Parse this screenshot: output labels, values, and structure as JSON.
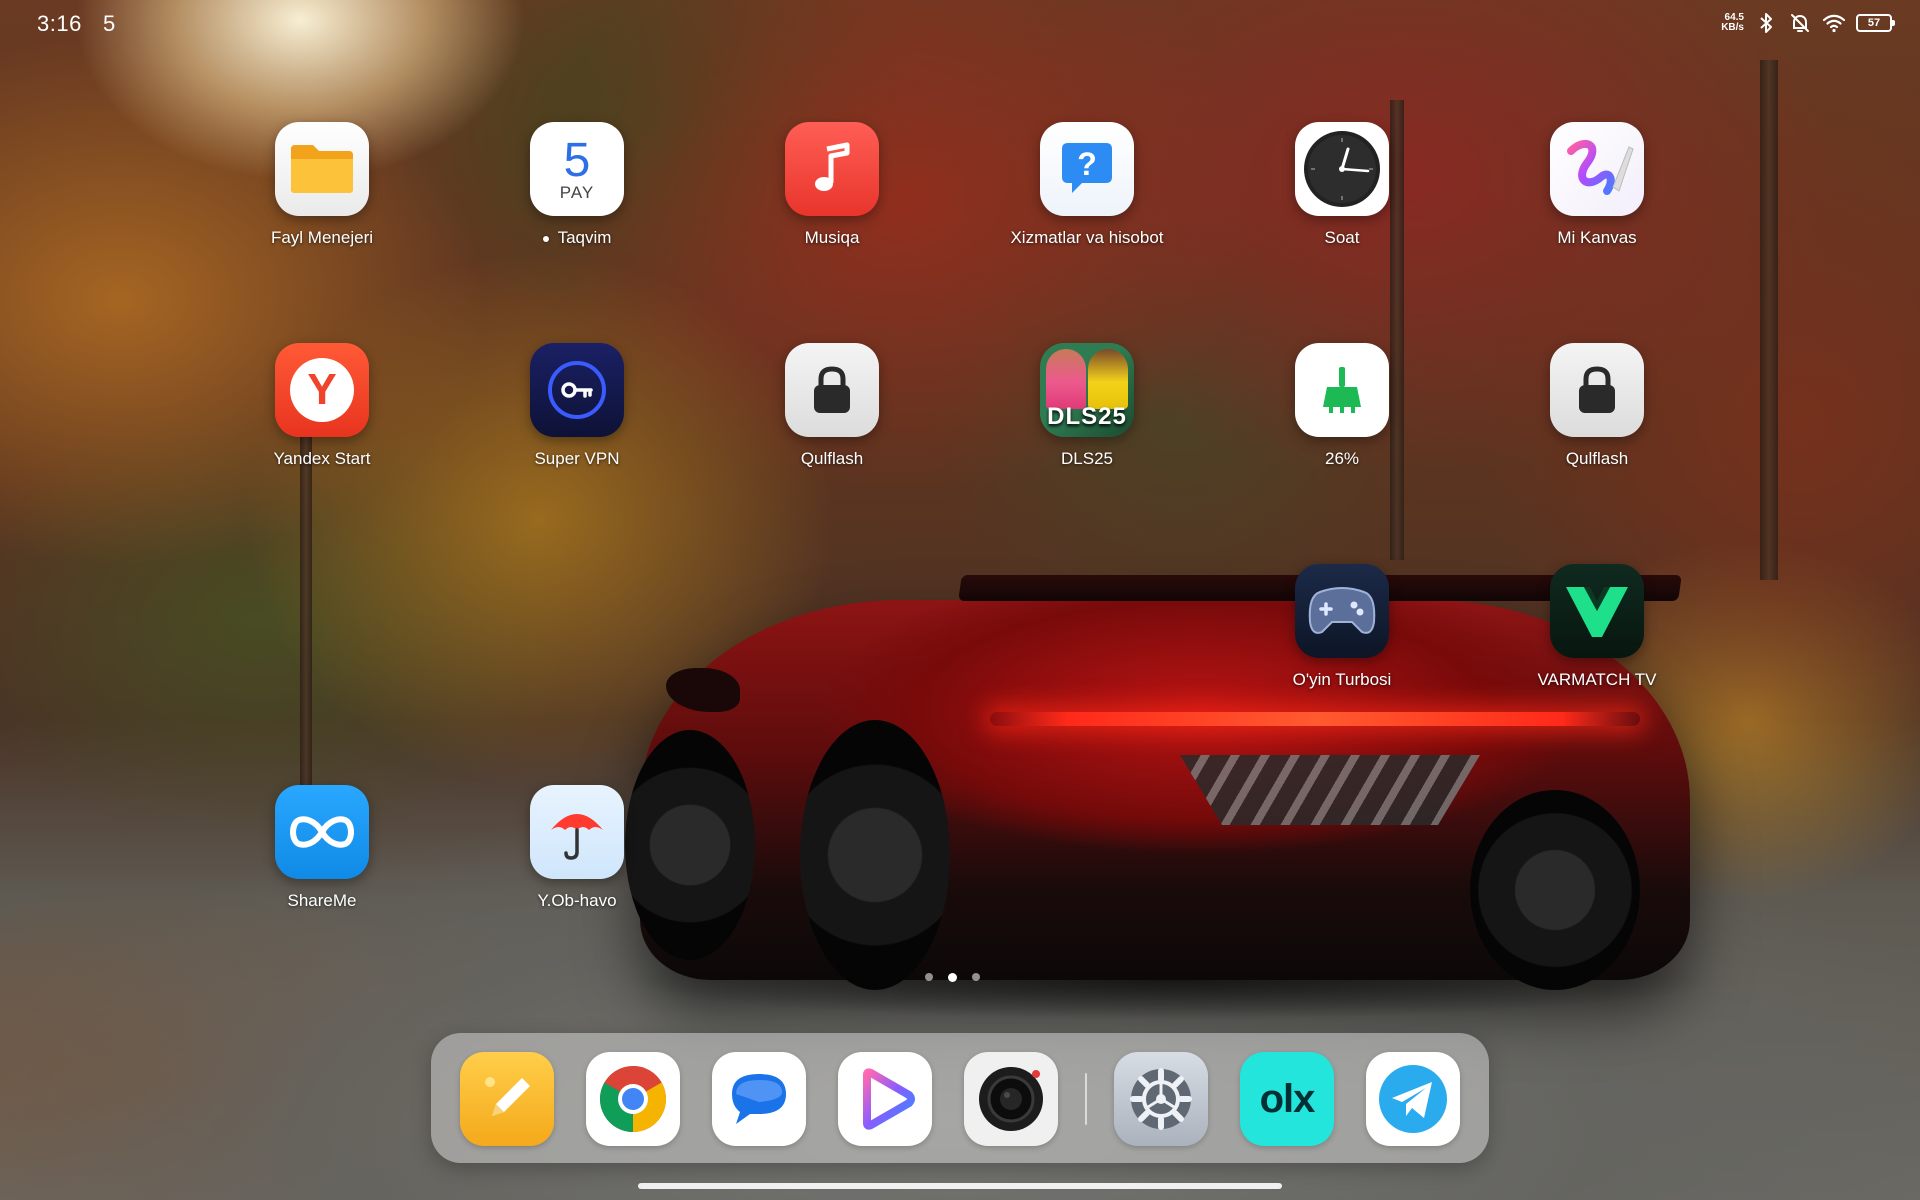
{
  "status_bar": {
    "time": "3:16",
    "date": "5",
    "net_speed_value": "64.5",
    "net_speed_unit": "KB/s",
    "battery": "57"
  },
  "apps": {
    "file_manager": {
      "label": "Fayl Menejeri",
      "icon": "folder-icon"
    },
    "calendar": {
      "label": "Taqvim",
      "day": "5",
      "weekday": "PAY",
      "icon": "calendar-icon"
    },
    "music": {
      "label": "Musiqa",
      "icon": "music-note-icon"
    },
    "services": {
      "label": "Xizmatlar va hisobot",
      "icon": "question-bubble-icon"
    },
    "clock": {
      "label": "Soat",
      "icon": "clock-icon"
    },
    "mi_canvas": {
      "label": "Mi Kanvas",
      "icon": "brush-stroke-icon"
    },
    "yandex_start": {
      "label": "Yandex Start",
      "glyph": "Y",
      "icon": "yandex-icon"
    },
    "super_vpn": {
      "label": "Super VPN",
      "icon": "key-icon"
    },
    "lock_1": {
      "label": "Qulflash",
      "icon": "padlock-icon"
    },
    "dls25": {
      "label": "DLS25",
      "icon_text": "DLS25",
      "icon": "dls25-icon"
    },
    "cleaner": {
      "label": "26%",
      "icon": "broom-icon"
    },
    "lock_2": {
      "label": "Qulflash",
      "icon": "padlock-icon"
    },
    "game_turbo": {
      "label": "O'yin Turbosi",
      "icon": "gamepad-icon"
    },
    "varmatch_tv": {
      "label": "VARMATCH TV",
      "icon": "varmatch-logo-icon"
    },
    "shareme": {
      "label": "ShareMe",
      "icon": "infinity-icon"
    },
    "weather": {
      "label": "Y.Ob-havo",
      "icon": "umbrella-icon"
    }
  },
  "page_indicator": {
    "total": 3,
    "active": 2
  },
  "dock": {
    "items": [
      {
        "name": "notes",
        "icon": "notes-pencil-icon"
      },
      {
        "name": "chrome",
        "icon": "chrome-icon"
      },
      {
        "name": "messages",
        "icon": "chat-bubble-icon"
      },
      {
        "name": "video-player",
        "icon": "play-icon"
      },
      {
        "name": "camera",
        "icon": "camera-lens-icon"
      },
      {
        "name": "settings",
        "icon": "gear-icon"
      },
      {
        "name": "olx",
        "icon_text": "olx",
        "icon": "olx-icon"
      },
      {
        "name": "telegram",
        "icon": "paper-plane-icon"
      }
    ]
  },
  "colors": {
    "folder_yellow": "#F5A623",
    "music_red": "#F2453D",
    "services_blue": "#2C8CF4",
    "yandex_red": "#F0432C",
    "vpn_navy": "#141A4A",
    "cleaner_green": "#1DB954",
    "shareme_blue": "#1E9BF0",
    "olx_teal": "#23E5DB",
    "telegram_blue": "#2AABEE"
  }
}
